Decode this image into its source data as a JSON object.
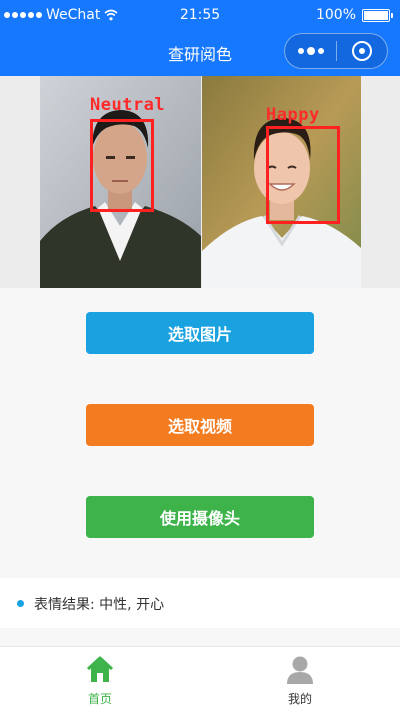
{
  "status_bar": {
    "carrier": "WeChat",
    "time": "21:55",
    "battery": "100%"
  },
  "nav": {
    "title": "查研阅色"
  },
  "images": [
    {
      "label": "Neutral"
    },
    {
      "label": "Happy"
    }
  ],
  "buttons": {
    "select_image": "选取图片",
    "select_video": "选取视频",
    "use_camera": "使用摄像头"
  },
  "result": {
    "text": "表情结果: 中性, 开心"
  },
  "tabs": [
    {
      "label": "首页",
      "icon": "home-icon",
      "active": true
    },
    {
      "label": "我的",
      "icon": "user-icon",
      "active": false
    }
  ],
  "colors": {
    "nav": "#1677ff",
    "select_image": "#1aa1e0",
    "select_video": "#f47c20",
    "use_camera": "#3db34a",
    "face_box": "#ff2020",
    "tab_active": "#3db34a"
  }
}
